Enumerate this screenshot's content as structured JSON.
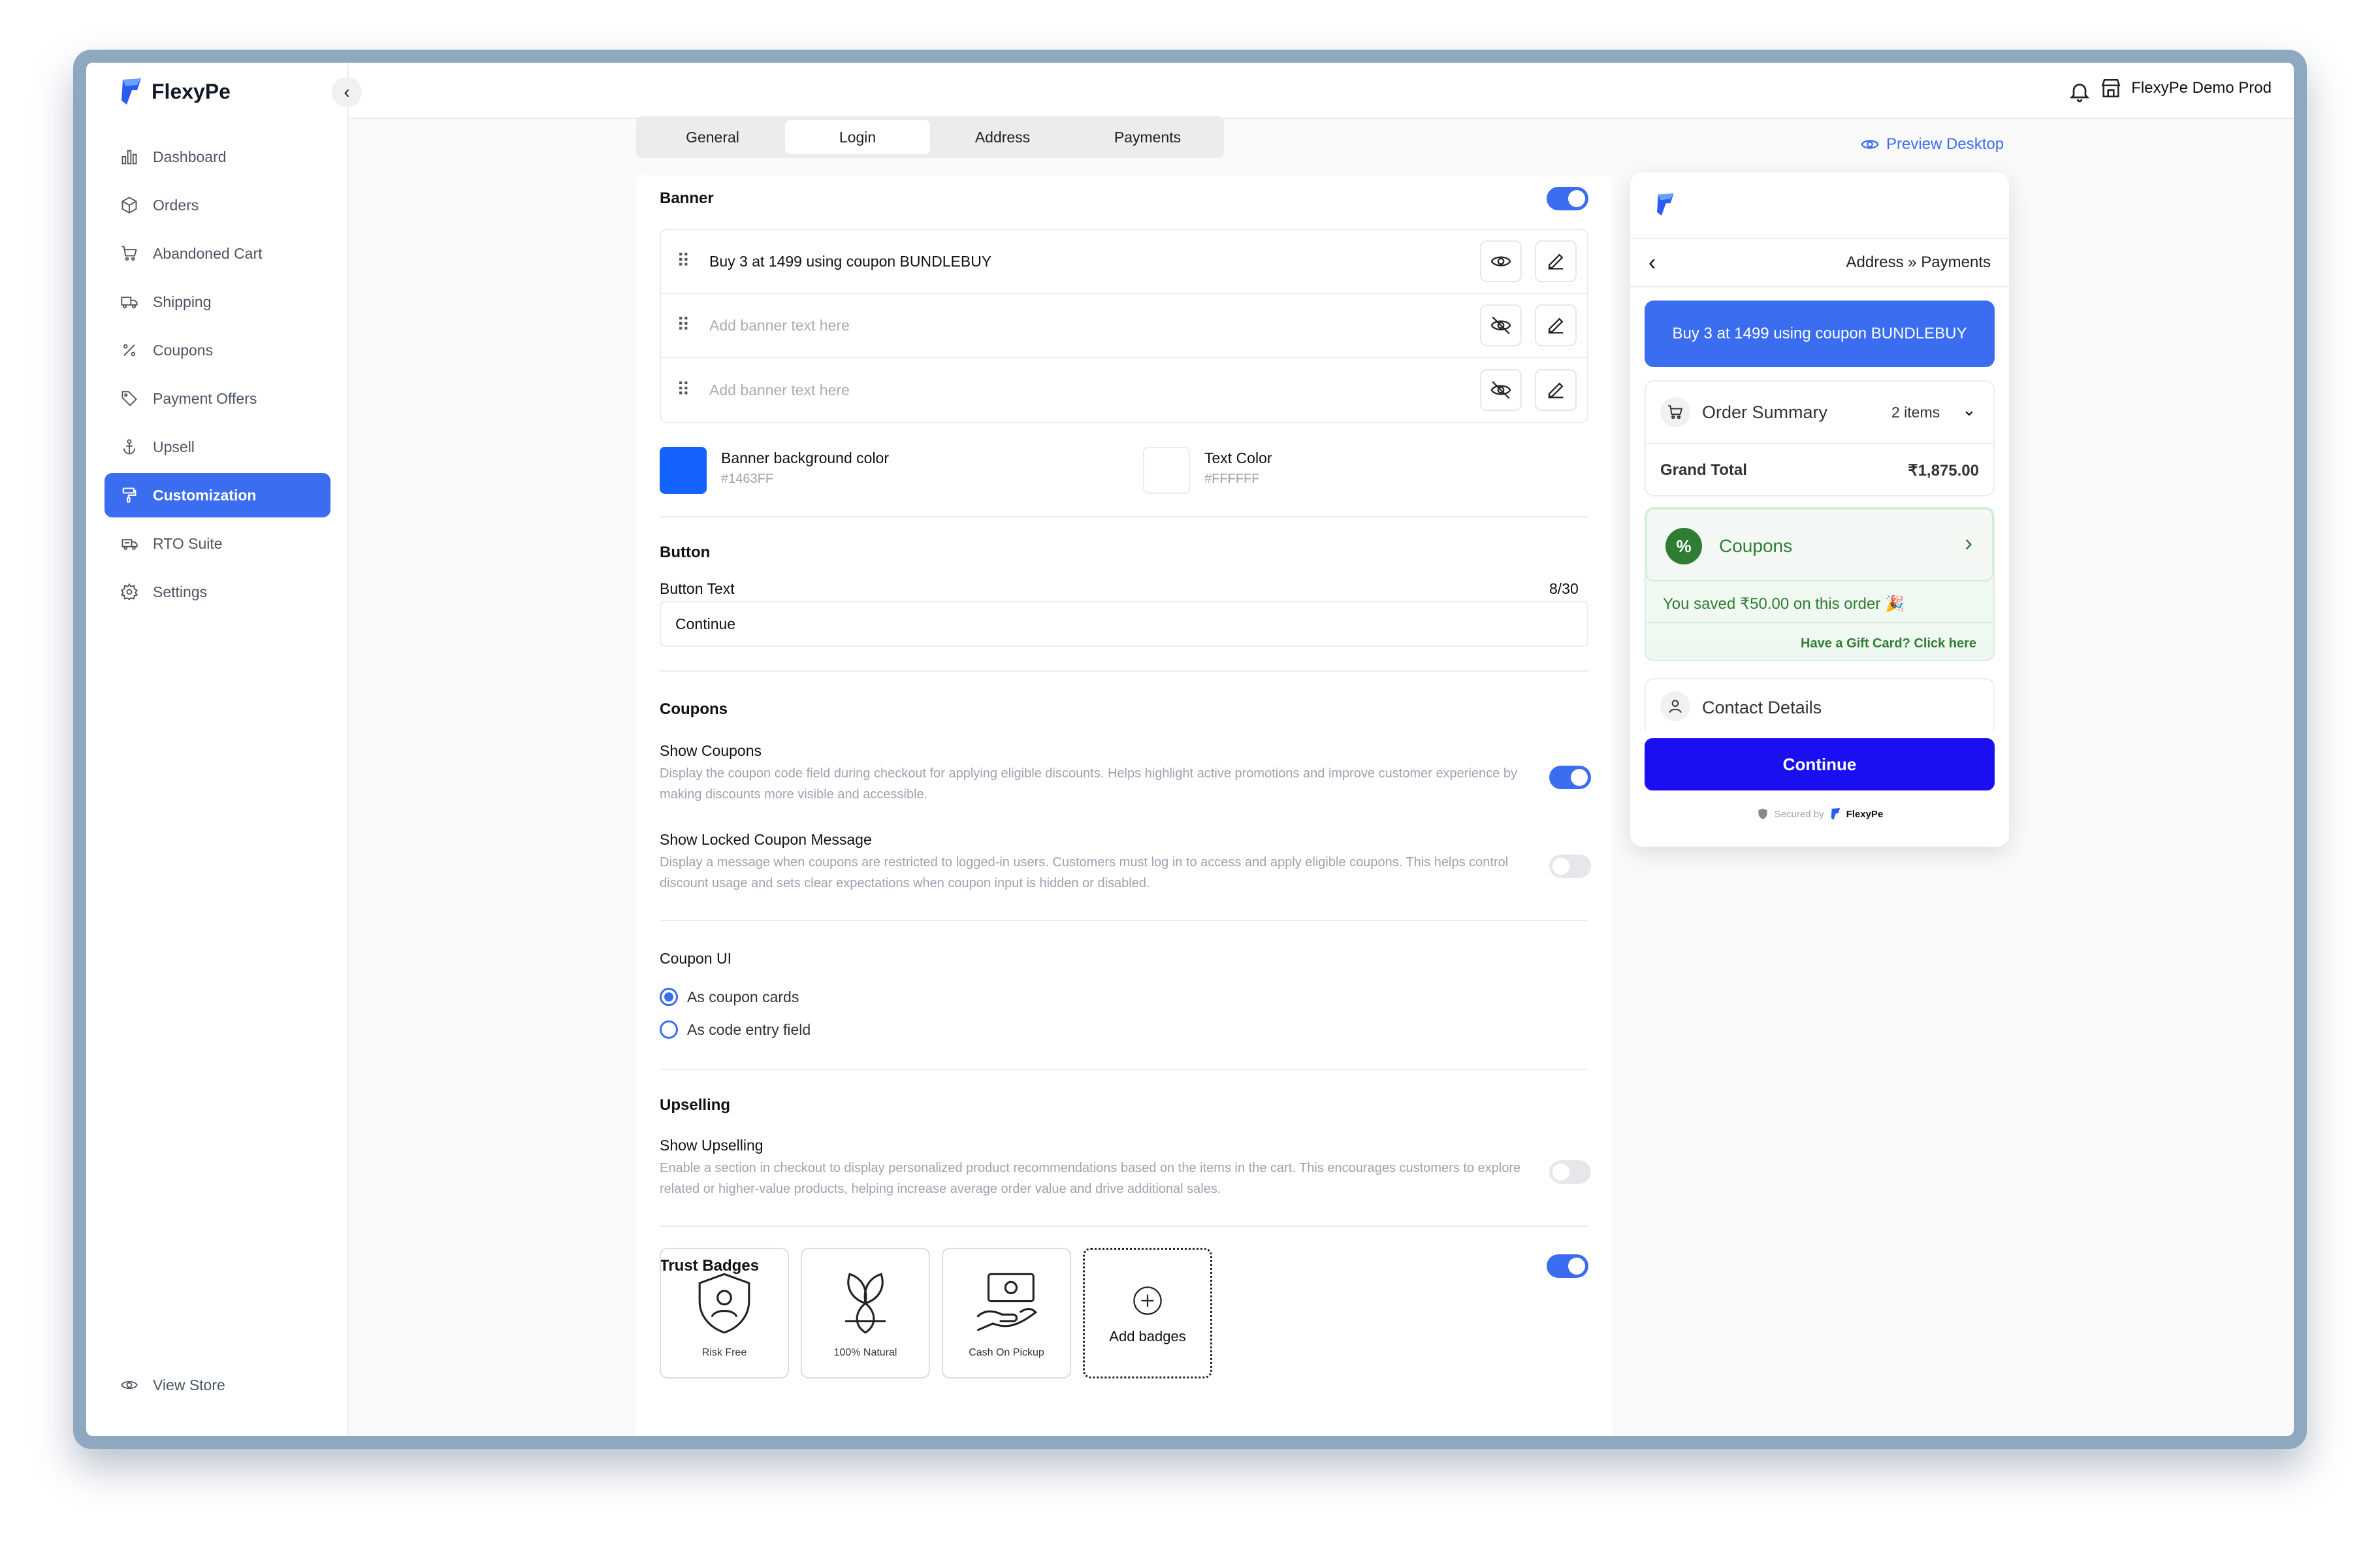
{
  "app": {
    "brand": "FlexyPe",
    "store_name": "FlexyPe Demo Prod"
  },
  "sidebar": {
    "items": [
      {
        "label": "Dashboard",
        "icon": "bar-chart-icon"
      },
      {
        "label": "Orders",
        "icon": "box-icon"
      },
      {
        "label": "Abandoned Cart",
        "icon": "cart-icon"
      },
      {
        "label": "Shipping",
        "icon": "truck-icon"
      },
      {
        "label": "Coupons",
        "icon": "percent-icon"
      },
      {
        "label": "Payment Offers",
        "icon": "tag-icon"
      },
      {
        "label": "Upsell",
        "icon": "anchor-icon"
      },
      {
        "label": "Customization",
        "icon": "paint-roller-icon",
        "active": true
      },
      {
        "label": "RTO Suite",
        "icon": "truck-return-icon"
      },
      {
        "label": "Settings",
        "icon": "gear-icon"
      }
    ],
    "view_store": "View Store"
  },
  "tabs": [
    "General",
    "Login",
    "Address",
    "Payments"
  ],
  "active_tab": "Login",
  "banner": {
    "title": "Banner",
    "enabled": true,
    "rows": [
      {
        "text": "Buy 3 at 1499 using coupon BUNDLEBUY",
        "placeholder": false,
        "visible": true
      },
      {
        "text": "Add banner text here",
        "placeholder": true,
        "visible": false
      },
      {
        "text": "Add banner text here",
        "placeholder": true,
        "visible": false
      }
    ],
    "bg_color_label": "Banner background color",
    "bg_color_value": "#1463FF",
    "text_color_label": "Text Color",
    "text_color_value": "#FFFFFF"
  },
  "button": {
    "title": "Button",
    "field_label": "Button Text",
    "counter": "8/30",
    "value": "Continue"
  },
  "coupons": {
    "title": "Coupons",
    "show_label": "Show Coupons",
    "show_desc": "Display the coupon code field during checkout for applying eligible discounts. Helps highlight active promotions and improve customer experience by making discounts more visible and accessible.",
    "show_enabled": true,
    "locked_label": "Show Locked Coupon Message",
    "locked_desc": "Display a message when coupons are restricted to logged-in users. Customers must log in to access and apply eligible coupons. This helps control discount usage and sets clear expectations when coupon input is hidden or disabled.",
    "locked_enabled": false
  },
  "coupon_ui": {
    "title": "Coupon UI",
    "options": [
      "As coupon cards",
      "As code entry field"
    ],
    "selected": "As coupon cards"
  },
  "upselling": {
    "title": "Upselling",
    "label": "Show Upselling",
    "desc": "Enable a section in checkout to display personalized product recommendations based on the items in the cart. This encourages customers to explore related or higher-value products, helping increase average order value and drive additional sales.",
    "enabled": false
  },
  "trust_badges": {
    "title": "Trust Badges",
    "enabled": true,
    "badges": [
      {
        "label": "Risk Free",
        "icon": "shield-user-icon"
      },
      {
        "label": "100% Natural",
        "icon": "leaves-icon"
      },
      {
        "label": "Cash On Pickup",
        "icon": "cash-hand-icon"
      }
    ],
    "add_label": "Add badges"
  },
  "preview": {
    "link": "Preview Desktop",
    "step_from": "Address",
    "step_to": "Payments",
    "banner_text": "Buy 3 at 1499 using coupon BUNDLEBUY",
    "order_summary": "Order Summary",
    "items": "2 items",
    "grand_total_label": "Grand Total",
    "grand_total_value": "₹1,875.00",
    "coupons_label": "Coupons",
    "saved_text": "You saved ₹50.00 on this order 🎉",
    "gift_card": "Have a Gift Card? Click here",
    "contact_details": "Contact Details",
    "continue": "Continue",
    "secured_by": "Secured by",
    "secured_brand": "FlexyPe"
  },
  "colors": {
    "accent": "#3b6df0",
    "continue": "#1a0ff0",
    "coupon_green": "#2e7d32"
  }
}
